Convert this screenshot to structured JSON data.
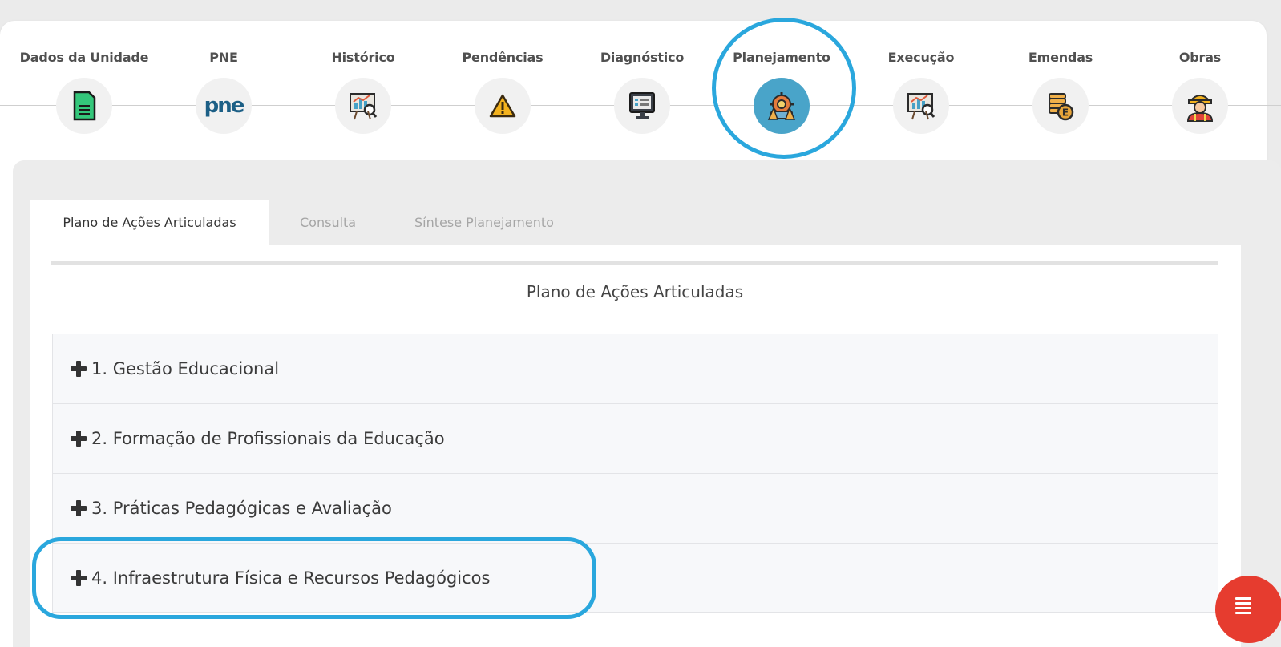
{
  "steps": [
    {
      "label": "Dados da Unidade",
      "icon": "document-icon"
    },
    {
      "label": "PNE",
      "icon": "pne-logo-icon",
      "logo_text": "pne"
    },
    {
      "label": "Histórico",
      "icon": "chart-board-search-icon"
    },
    {
      "label": "Pendências",
      "icon": "warning-icon"
    },
    {
      "label": "Diagnóstico",
      "icon": "monitor-report-icon"
    },
    {
      "label": "Planejamento",
      "icon": "planning-gear-icon",
      "active": true
    },
    {
      "label": "Execução",
      "icon": "chart-board-search-icon"
    },
    {
      "label": "Emendas",
      "icon": "coins-icon"
    },
    {
      "label": "Obras",
      "icon": "construction-worker-icon"
    }
  ],
  "tabs": [
    {
      "label": "Plano de Ações Articuladas",
      "active": true
    },
    {
      "label": "Consulta",
      "active": false
    },
    {
      "label": "Síntese Planejamento",
      "active": false
    }
  ],
  "section_title": "Plano de Ações Articuladas",
  "accordion": [
    {
      "label": "1. Gestão Educacional"
    },
    {
      "label": "2. Formação de Profissionais da Educação"
    },
    {
      "label": "3. Práticas Pedagógicas e Avaliação"
    },
    {
      "label": "4. Infraestrutura Física e Recursos Pedagógicos"
    }
  ],
  "colors": {
    "highlight": "#2aa7dd",
    "active_step": "#49a4c9",
    "fab": "#e63c2f"
  },
  "fab": {
    "icon": "menu-lines-icon"
  }
}
